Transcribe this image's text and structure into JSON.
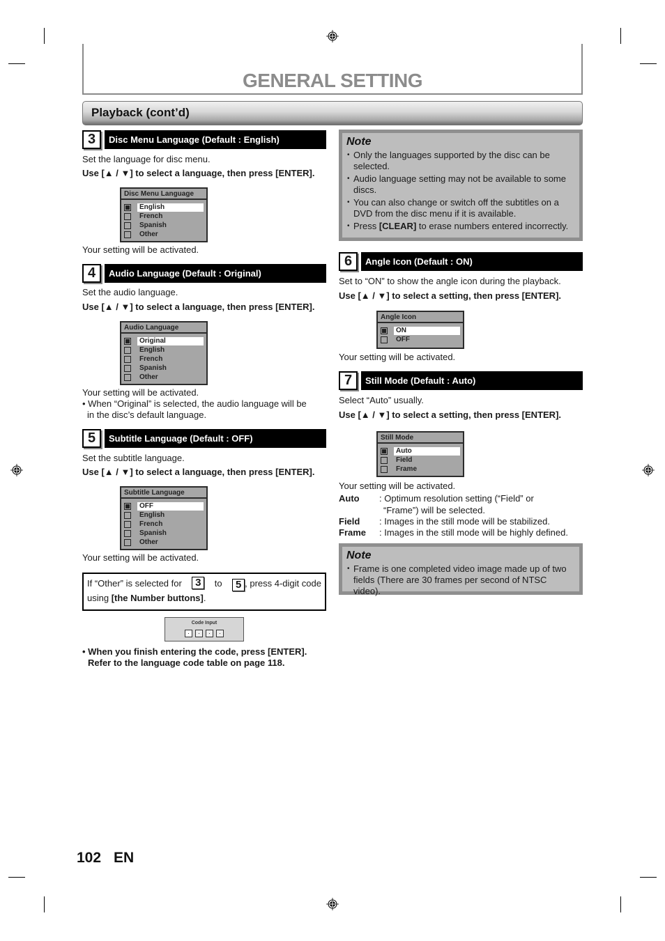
{
  "header": {
    "page_title": "GENERAL SETTING",
    "section_title": "Playback (cont’d)"
  },
  "steps": {
    "s3": {
      "number": "3",
      "title": "Disc Menu Language (Default : English)",
      "desc": "Set the language for disc menu.",
      "instruction": "Use [▲ / ▼] to select a language, then press [ENTER].",
      "menu": {
        "title": "Disc Menu Language",
        "options": [
          "English",
          "French",
          "Spanish",
          "Other"
        ],
        "selected": "English"
      },
      "result": "Your setting will be activated."
    },
    "s4": {
      "number": "4",
      "title": "Audio Language (Default : Original)",
      "desc": "Set the audio language.",
      "instruction": "Use [▲ / ▼] to select a language, then press [ENTER].",
      "menu": {
        "title": "Audio Language",
        "options": [
          "Original",
          "English",
          "French",
          "Spanish",
          "Other"
        ],
        "selected": "Original"
      },
      "result": "Your setting will be activated.",
      "bullet_line1": "• When “Original” is selected, the audio language will be",
      "bullet_line2": "in the disc’s default language."
    },
    "s5": {
      "number": "5",
      "title": "Subtitle Language (Default : OFF)",
      "desc": "Set the subtitle language.",
      "instruction": "Use [▲ / ▼] to select a language, then press [ENTER].",
      "menu": {
        "title": "Subtitle Language",
        "options": [
          "OFF",
          "English",
          "French",
          "Spanish",
          "Other"
        ],
        "selected": "OFF"
      },
      "result": "Your setting will be activated."
    },
    "s6": {
      "number": "6",
      "title": "Angle Icon (Default : ON)",
      "desc": "Set to “ON” to show the angle icon during the playback.",
      "instruction": "Use [▲ / ▼] to select a setting, then press [ENTER].",
      "menu": {
        "title": "Angle Icon",
        "options": [
          "ON",
          "OFF"
        ],
        "selected": "ON"
      },
      "result": "Your setting will be activated."
    },
    "s7": {
      "number": "7",
      "title": "Still Mode (Default : Auto)",
      "desc": "Select “Auto” usually.",
      "instruction": "Use [▲ / ▼] to select a setting, then press [ENTER].",
      "menu": {
        "title": "Still Mode",
        "options": [
          "Auto",
          "Field",
          "Frame"
        ],
        "selected": "Auto"
      },
      "result": "Your setting will be activated.",
      "definitions": [
        {
          "term": "Auto",
          "desc_line1": ": Optimum resolution setting (“Field” or",
          "desc_line2": "“Frame”) will be selected."
        },
        {
          "term": "Field",
          "desc_line1": ": Images in the still mode will be stabilized."
        },
        {
          "term": "Frame",
          "desc_line1": ": Images in the still mode will be highly defined."
        }
      ]
    }
  },
  "other_box": {
    "prefix": "If “Other” is selected for",
    "from_num": "3",
    "to_word": "to",
    "to_num": "5",
    "suffix": ", press 4-digit code",
    "line2_prefix": "using ",
    "line2_bold": "[the Number buttons]",
    "line2_suffix": "."
  },
  "code_input": {
    "title": "Code Input",
    "digits": 4
  },
  "finish_note": {
    "line1": "• When you finish entering the code, press [ENTER].",
    "line2": "Refer to the language code table on page 118."
  },
  "note1": {
    "title": "Note",
    "items": [
      "Only the languages supported by the disc can be selected.",
      "Audio language setting may not be available to some discs.",
      "You can also change or switch off the subtitles on a DVD from the disc menu if it is available."
    ],
    "last_prefix": "Press ",
    "last_bold": "[CLEAR]",
    "last_suffix": " to erase numbers entered incorrectly."
  },
  "note2": {
    "title": "Note",
    "items": [
      "Frame is one completed video image made up of two fields (There are 30 frames per second of NTSC video)."
    ]
  },
  "footer": {
    "page_number": "102",
    "language": "EN"
  }
}
